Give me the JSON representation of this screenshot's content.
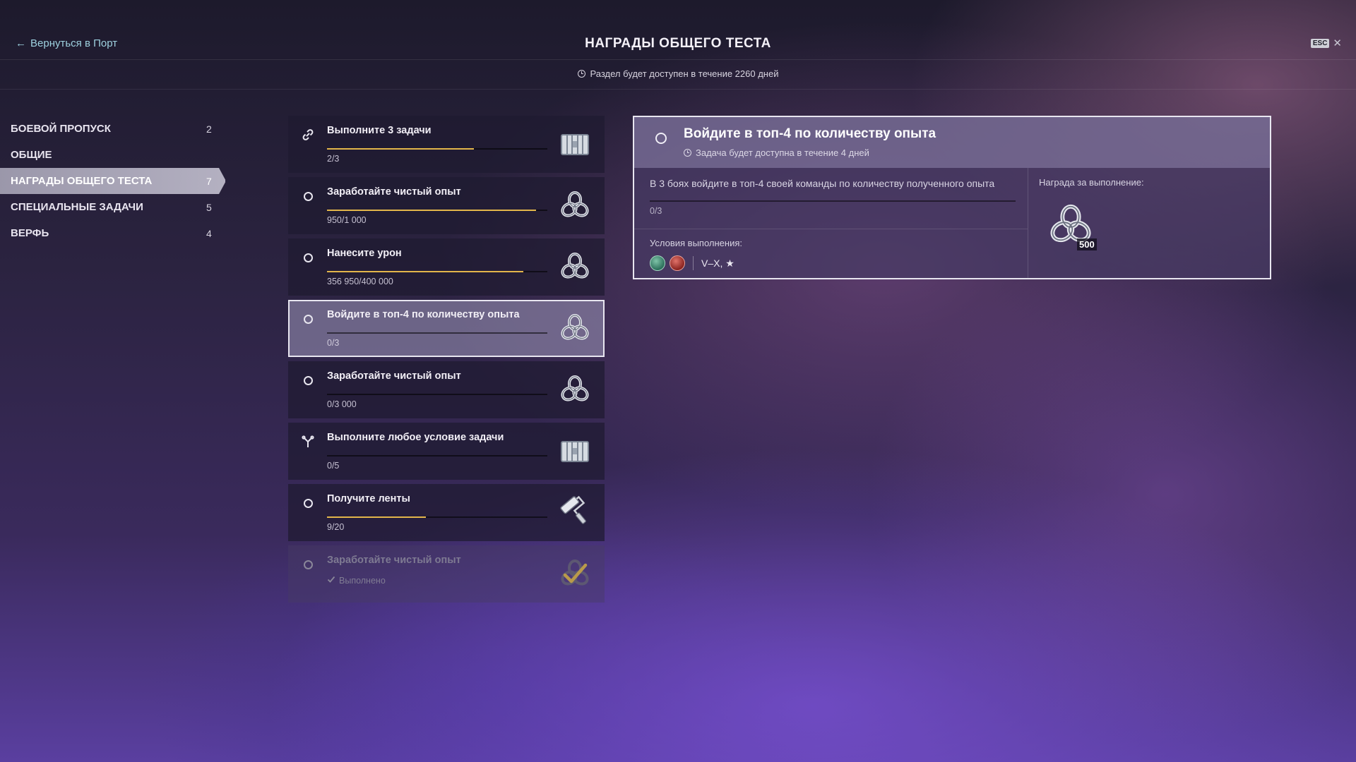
{
  "header": {
    "back_label": "Вернуться в Порт",
    "title": "НАГРАДЫ ОБЩЕГО ТЕСТА",
    "esc_label": "ESC",
    "close_symbol": "✕",
    "availability": "Раздел будет доступен в течение 2260 дней"
  },
  "sidebar": {
    "items": [
      {
        "label": "БОЕВОЙ ПРОПУСК",
        "count": "2"
      },
      {
        "label": "ОБЩИЕ",
        "count": ""
      },
      {
        "label": "НАГРАДЫ ОБЩЕГО ТЕСТА",
        "count": "7"
      },
      {
        "label": "СПЕЦИАЛЬНЫЕ ЗАДАЧИ",
        "count": "5"
      },
      {
        "label": "ВЕРФЬ",
        "count": "4"
      }
    ],
    "active_index": 2
  },
  "tasks": [
    {
      "title": "Выполните 3 задачи",
      "progress": "2/3",
      "fraction": 0.667,
      "status_icon": "chain-link-icon",
      "reward_icon": "container-icon"
    },
    {
      "title": "Заработайте чистый опыт",
      "progress": "950/1 000",
      "fraction": 0.95,
      "status_icon": "radio-icon",
      "reward_icon": "steel-icon"
    },
    {
      "title": "Нанесите урон",
      "progress": "356 950/400 000",
      "fraction": 0.892,
      "status_icon": "radio-icon",
      "reward_icon": "steel-icon"
    },
    {
      "title": "Войдите в топ-4 по количеству опыта",
      "progress": "0/3",
      "fraction": 0,
      "status_icon": "radio-icon",
      "reward_icon": "steel-icon",
      "selected": true
    },
    {
      "title": "Заработайте чистый опыт",
      "progress": "0/3 000",
      "fraction": 0,
      "status_icon": "radio-icon",
      "reward_icon": "steel-icon"
    },
    {
      "title": "Выполните любое условие задачи",
      "progress": "0/5",
      "fraction": 0,
      "status_icon": "branch-icon",
      "reward_icon": "container-icon"
    },
    {
      "title": "Получите ленты",
      "progress": "9/20",
      "fraction": 0.45,
      "status_icon": "radio-icon",
      "reward_icon": "paint-roller-icon"
    },
    {
      "title": "Заработайте чистый опыт",
      "done_label": "Выполнено",
      "status_icon": "radio-icon",
      "reward_icon": "steel-done-icon",
      "done": true
    }
  ],
  "detail": {
    "title": "Войдите в топ-4 по количеству опыта",
    "availability": "Задача будет доступна в течение 4 дней",
    "description": "В 3 боях войдите в топ-4 своей команды по количеству полученного опыта",
    "progress": "0/3",
    "progress_fraction": 0,
    "conditions_label": "Условия выполнения:",
    "conditions_text": "V–X, ★",
    "condition_icons": [
      "nation-green-icon",
      "nation-red-icon"
    ],
    "reward_label": "Награда за выполнение:",
    "reward_count": "500",
    "reward_icon": "steel-icon"
  },
  "colors": {
    "progress_fill": "#e3b64a",
    "back_link": "#9ed1df",
    "selected_border": "#e8e6f0"
  }
}
